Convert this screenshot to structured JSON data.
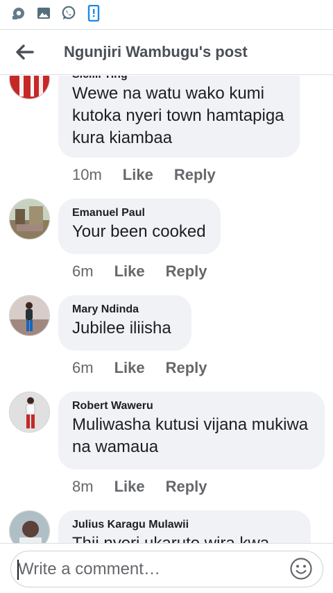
{
  "status_bar": {
    "icons": [
      "chrome-remote-icon",
      "gallery-icon",
      "whatsapp-icon",
      "phone-alert-icon"
    ]
  },
  "header": {
    "back_icon": "arrow-left-icon",
    "title": "Ngunjiri Wambugu's post"
  },
  "comments": [
    {
      "author": "Sicilli Ting",
      "text_lines": [
        "Wewe na watu wako kumi",
        "kutoka nyeri town hamtapiga",
        "kura kiambaa"
      ],
      "time": "10m",
      "like_label": "Like",
      "reply_label": "Reply"
    },
    {
      "author": "Emanuel Paul",
      "text_lines": [
        "Your been cooked"
      ],
      "time": "6m",
      "like_label": "Like",
      "reply_label": "Reply"
    },
    {
      "author": "Mary Ndinda",
      "text_lines": [
        "Jubilee iliisha"
      ],
      "time": "6m",
      "like_label": "Like",
      "reply_label": "Reply"
    },
    {
      "author": "Robert Waweru",
      "text_lines": [
        "Muliwasha kutusi vijana mukiwa",
        "na wamaua"
      ],
      "time": "8m",
      "like_label": "Like",
      "reply_label": "Reply"
    },
    {
      "author": "Julius Karagu Mulawii",
      "text_lines": [
        "Thii nyeri ukarute wira kwa tiga"
      ],
      "time": "",
      "like_label": "",
      "reply_label": ""
    }
  ],
  "composer": {
    "placeholder": "Write a comment…",
    "emoji_icon": "smiley-icon"
  },
  "colors": {
    "bubble": "#f0f2f5",
    "secondary_text": "#65676b",
    "title_text": "#4b4f56",
    "whatsapp": "#25d366",
    "notify_blue": "#1e88e5"
  }
}
